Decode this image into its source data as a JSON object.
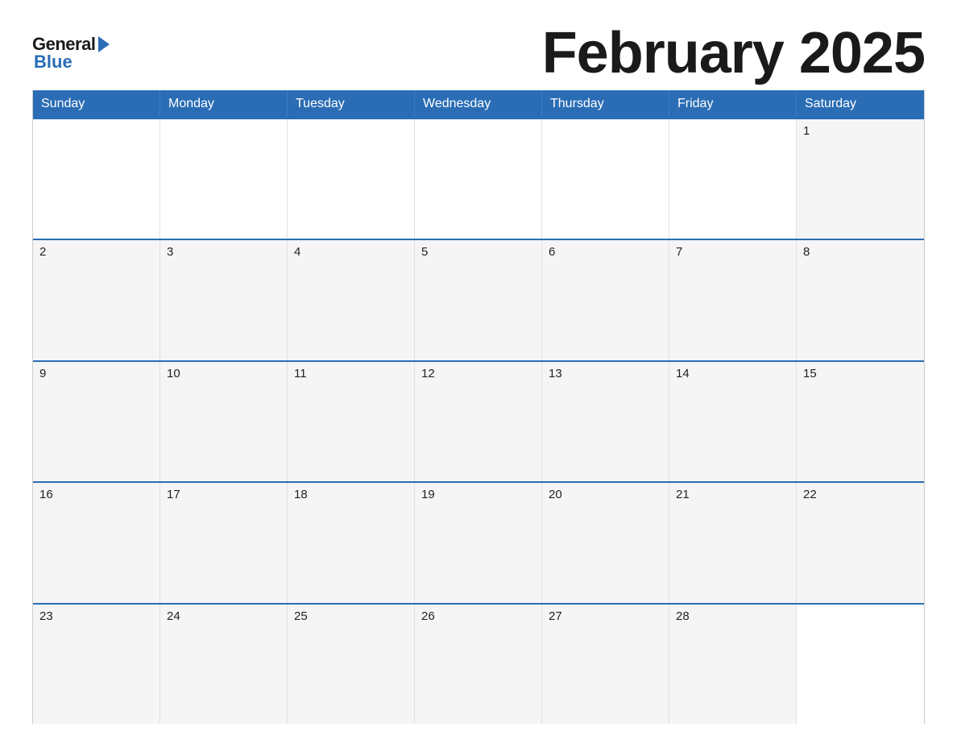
{
  "header": {
    "logo_general": "General",
    "logo_blue": "Blue",
    "month_title": "February 2025"
  },
  "calendar": {
    "day_headers": [
      "Sunday",
      "Monday",
      "Tuesday",
      "Wednesday",
      "Thursday",
      "Friday",
      "Saturday"
    ],
    "weeks": [
      [
        {
          "day": "",
          "empty": true
        },
        {
          "day": "",
          "empty": true
        },
        {
          "day": "",
          "empty": true
        },
        {
          "day": "",
          "empty": true
        },
        {
          "day": "",
          "empty": true
        },
        {
          "day": "",
          "empty": true
        },
        {
          "day": "1",
          "empty": false
        }
      ],
      [
        {
          "day": "2",
          "empty": false
        },
        {
          "day": "3",
          "empty": false
        },
        {
          "day": "4",
          "empty": false
        },
        {
          "day": "5",
          "empty": false
        },
        {
          "day": "6",
          "empty": false
        },
        {
          "day": "7",
          "empty": false
        },
        {
          "day": "8",
          "empty": false
        }
      ],
      [
        {
          "day": "9",
          "empty": false
        },
        {
          "day": "10",
          "empty": false
        },
        {
          "day": "11",
          "empty": false
        },
        {
          "day": "12",
          "empty": false
        },
        {
          "day": "13",
          "empty": false
        },
        {
          "day": "14",
          "empty": false
        },
        {
          "day": "15",
          "empty": false
        }
      ],
      [
        {
          "day": "16",
          "empty": false
        },
        {
          "day": "17",
          "empty": false
        },
        {
          "day": "18",
          "empty": false
        },
        {
          "day": "19",
          "empty": false
        },
        {
          "day": "20",
          "empty": false
        },
        {
          "day": "21",
          "empty": false
        },
        {
          "day": "22",
          "empty": false
        }
      ],
      [
        {
          "day": "23",
          "empty": false
        },
        {
          "day": "24",
          "empty": false
        },
        {
          "day": "25",
          "empty": false
        },
        {
          "day": "26",
          "empty": false
        },
        {
          "day": "27",
          "empty": false
        },
        {
          "day": "28",
          "empty": false
        },
        {
          "day": "",
          "empty": true
        }
      ]
    ]
  }
}
